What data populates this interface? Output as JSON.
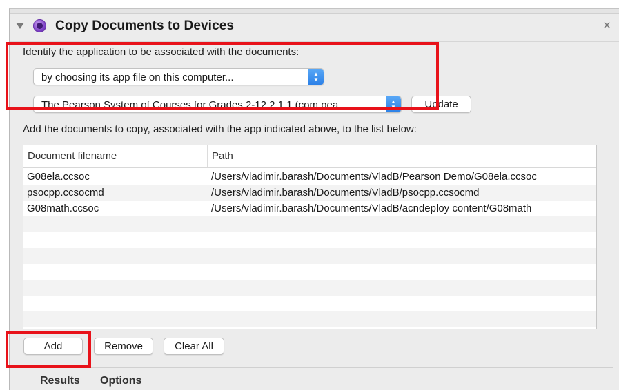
{
  "action": {
    "title": "Copy Documents to Devices",
    "close_glyph": "×",
    "icon": "purple-app-icon"
  },
  "app_section": {
    "label": "Identify the application to be associated with the documents:",
    "method_select": "by choosing its app file on this computer...",
    "app_select": "The Pearson System of Courses for Grades 2-12 2.1.1 (com.pea...",
    "update_button": "Update"
  },
  "documents_section": {
    "label": "Add the documents to copy, associated with the app indicated above, to the list below:",
    "columns": [
      "Document filename",
      "Path"
    ],
    "rows": [
      {
        "filename": "G08ela.ccsoc",
        "path": "/Users/vladimir.barash/Documents/VladB/Pearson Demo/G08ela.ccsoc"
      },
      {
        "filename": "psocpp.ccsocmd",
        "path": "/Users/vladimir.barash/Documents/VladB/psocpp.ccsocmd"
      },
      {
        "filename": "G08math.ccsoc",
        "path": "/Users/vladimir.barash/Documents/VladB/acndeploy content/G08math"
      }
    ]
  },
  "buttons": {
    "add": "Add",
    "remove": "Remove",
    "clear_all": "Clear All"
  },
  "footer_tabs": [
    "Results",
    "Options"
  ],
  "colors": {
    "highlight": "#e8121a",
    "select_accent": "#2a7fe6"
  }
}
